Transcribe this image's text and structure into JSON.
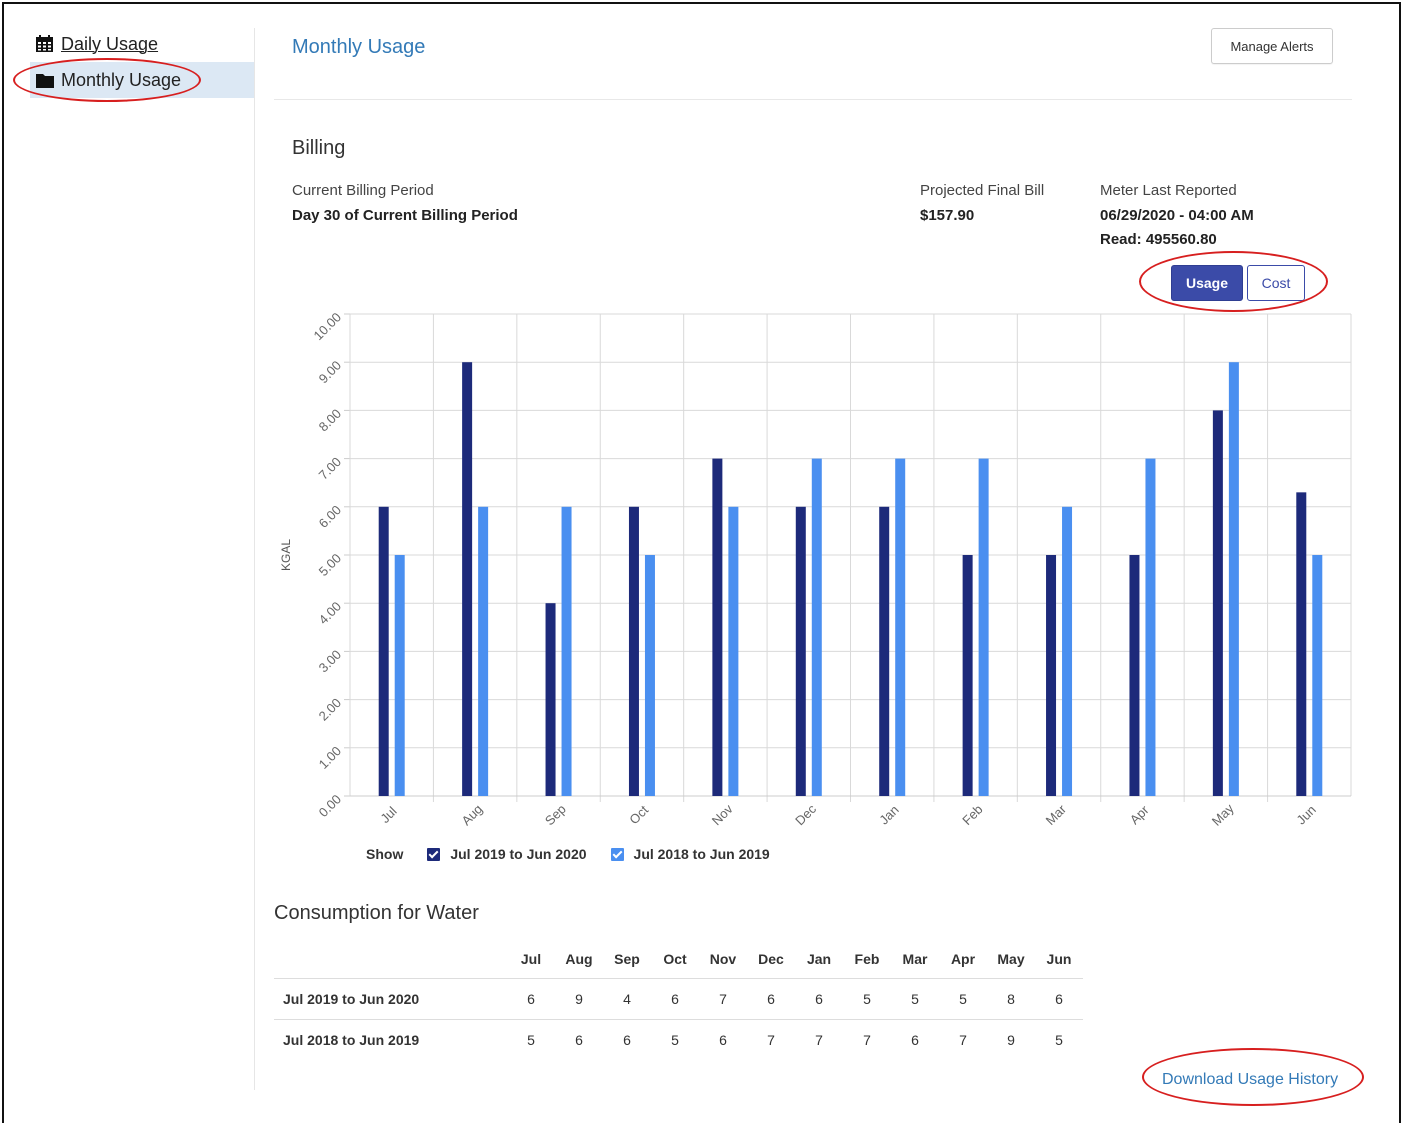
{
  "sidebar": {
    "items": [
      {
        "label": "Daily Usage",
        "icon": "calendar-icon",
        "active": false
      },
      {
        "label": "Monthly Usage",
        "icon": "folder-icon",
        "active": true
      }
    ]
  },
  "header": {
    "title": "Monthly Usage",
    "manage_alerts_label": "Manage Alerts"
  },
  "billing": {
    "title": "Billing",
    "current_period_label": "Current Billing Period",
    "current_period_value": "Day 30 of Current Billing Period",
    "projected_label": "Projected Final Bill",
    "projected_value": "$157.90",
    "meter_label": "Meter Last Reported",
    "meter_datetime": "06/29/2020 - 04:00 AM",
    "meter_read": "Read: 495560.80"
  },
  "toggle": {
    "usage_label": "Usage",
    "cost_label": "Cost",
    "selected": "Usage"
  },
  "chart_data": {
    "type": "bar",
    "ylabel": "KGAL",
    "ylim": [
      0,
      10
    ],
    "yticks": [
      "0.00",
      "1.00",
      "2.00",
      "3.00",
      "4.00",
      "5.00",
      "6.00",
      "7.00",
      "8.00",
      "9.00",
      "10.00"
    ],
    "categories": [
      "Jul",
      "Aug",
      "Sep",
      "Oct",
      "Nov",
      "Dec",
      "Jan",
      "Feb",
      "Mar",
      "Apr",
      "May",
      "Jun"
    ],
    "series": [
      {
        "name": "Jul 2019 to Jun 2020",
        "color": "#1d2a7a",
        "values": [
          6,
          9,
          4,
          6,
          7,
          6,
          6,
          5,
          5,
          5,
          8,
          6.3
        ]
      },
      {
        "name": "Jul 2018 to Jun 2019",
        "color": "#4a8ff0",
        "values": [
          5,
          6,
          6,
          5,
          6,
          7,
          7,
          7,
          6,
          7,
          9,
          5
        ]
      }
    ],
    "grid": true
  },
  "legend": {
    "show_label": "Show"
  },
  "consumption": {
    "title": "Consumption for Water",
    "months": [
      "Jul",
      "Aug",
      "Sep",
      "Oct",
      "Nov",
      "Dec",
      "Jan",
      "Feb",
      "Mar",
      "Apr",
      "May",
      "Jun"
    ],
    "rows": [
      {
        "label": "Jul 2019 to Jun 2020",
        "values": [
          "6",
          "9",
          "4",
          "6",
          "7",
          "6",
          "6",
          "5",
          "5",
          "5",
          "8",
          "6"
        ]
      },
      {
        "label": "Jul 2018 to Jun 2019",
        "values": [
          "5",
          "6",
          "6",
          "5",
          "6",
          "7",
          "7",
          "7",
          "6",
          "7",
          "9",
          "5"
        ]
      }
    ]
  },
  "download_label": "Download Usage History",
  "annotation_color": "#d71f1f"
}
